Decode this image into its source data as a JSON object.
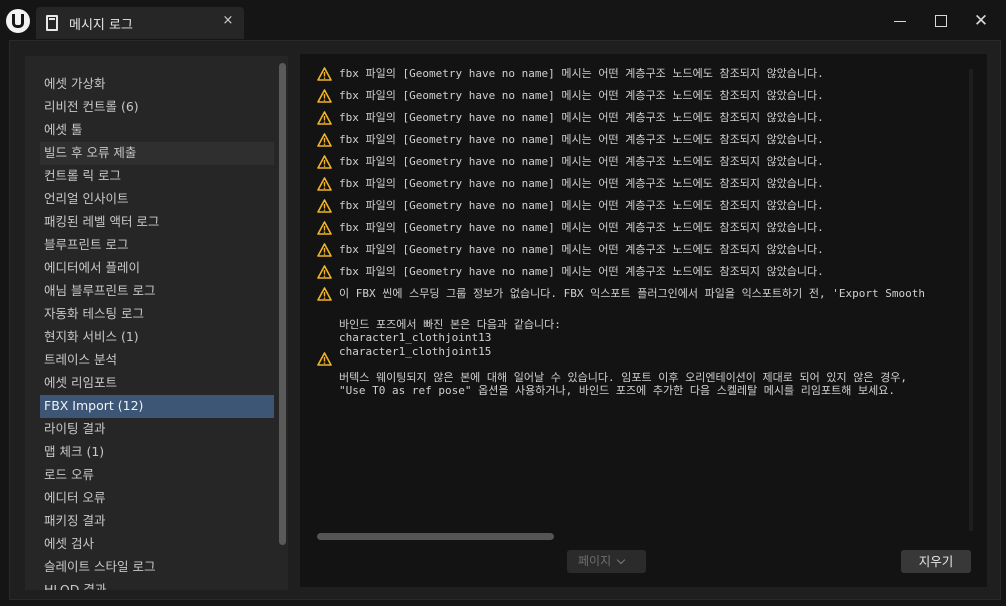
{
  "window": {
    "tab_title": "메시지 로그",
    "tab_close": "×",
    "close_glyph": "✕"
  },
  "sidebar": {
    "items": [
      {
        "label": "에셋 가상화"
      },
      {
        "label": "리비전 컨트롤 (6)"
      },
      {
        "label": "에셋 툴"
      },
      {
        "label": "빌드 후 오류 제출"
      },
      {
        "label": "컨트롤 릭 로그"
      },
      {
        "label": "언리얼 인사이트"
      },
      {
        "label": "패킹된 레벨 액터 로그"
      },
      {
        "label": "블루프린트 로그"
      },
      {
        "label": "에디터에서 플레이"
      },
      {
        "label": "애님 블루프린트 로그"
      },
      {
        "label": "자동화 테스팅 로그"
      },
      {
        "label": "현지화 서비스 (1)"
      },
      {
        "label": "트레이스 분석"
      },
      {
        "label": "에셋 리임포트"
      },
      {
        "label": "FBX Import (12)"
      },
      {
        "label": "라이팅 결과"
      },
      {
        "label": "맵 체크 (1)"
      },
      {
        "label": "로드 오류"
      },
      {
        "label": "에디터 오류"
      },
      {
        "label": "패키징 결과"
      },
      {
        "label": "에셋 검사"
      },
      {
        "label": "슬레이트 스타일 로그"
      },
      {
        "label": "HLOD 결과"
      }
    ],
    "hover_item": "빌드 후 오류 제출",
    "selected_item": "FBX Import (12)"
  },
  "log": {
    "messages": [
      {
        "severity": "warning",
        "text": "fbx 파일의 [Geometry have no name] 메시는 어떤 계층구조 노드에도 참조되지 않았습니다."
      },
      {
        "severity": "warning",
        "text": "fbx 파일의 [Geometry have no name] 메시는 어떤 계층구조 노드에도 참조되지 않았습니다."
      },
      {
        "severity": "warning",
        "text": "fbx 파일의 [Geometry have no name] 메시는 어떤 계층구조 노드에도 참조되지 않았습니다."
      },
      {
        "severity": "warning",
        "text": "fbx 파일의 [Geometry have no name] 메시는 어떤 계층구조 노드에도 참조되지 않았습니다."
      },
      {
        "severity": "warning",
        "text": "fbx 파일의 [Geometry have no name] 메시는 어떤 계층구조 노드에도 참조되지 않았습니다."
      },
      {
        "severity": "warning",
        "text": "fbx 파일의 [Geometry have no name] 메시는 어떤 계층구조 노드에도 참조되지 않았습니다."
      },
      {
        "severity": "warning",
        "text": "fbx 파일의 [Geometry have no name] 메시는 어떤 계층구조 노드에도 참조되지 않았습니다."
      },
      {
        "severity": "warning",
        "text": "fbx 파일의 [Geometry have no name] 메시는 어떤 계층구조 노드에도 참조되지 않았습니다."
      },
      {
        "severity": "warning",
        "text": "fbx 파일의 [Geometry have no name] 메시는 어떤 계층구조 노드에도 참조되지 않았습니다."
      },
      {
        "severity": "warning",
        "text": "fbx 파일의 [Geometry have no name] 메시는 어떤 계층구조 노드에도 참조되지 않았습니다."
      },
      {
        "severity": "warning",
        "text": "이 FBX 씬에 스무딩 그룹 정보가 없습니다. FBX 익스포트 플러그인에서 파일을 익스포트하기 전, 'Export Smooth"
      },
      {
        "severity": "warning",
        "text": "바인드 포즈에서 빠진 본은 다음과 같습니다:\ncharacter1_clothjoint13\ncharacter1_clothjoint15\n\n버텍스 웨이팅되지 않은 본에 대해 일어날 수 있습니다. 임포트 이후 오리엔테이션이 제대로 되어 있지 않은 경우,\n\"Use T0 as ref pose\" 옵션을 사용하거나, 바인드 포즈에 추가한 다음 스켈레탈 메시를 리임포트해 보세요."
      }
    ]
  },
  "footer": {
    "page_label": "페이지",
    "clear_label": "지우기"
  },
  "colors": {
    "selected_bg": "#3d5675",
    "warning": "#f0b429",
    "log_bg": "#131313"
  }
}
